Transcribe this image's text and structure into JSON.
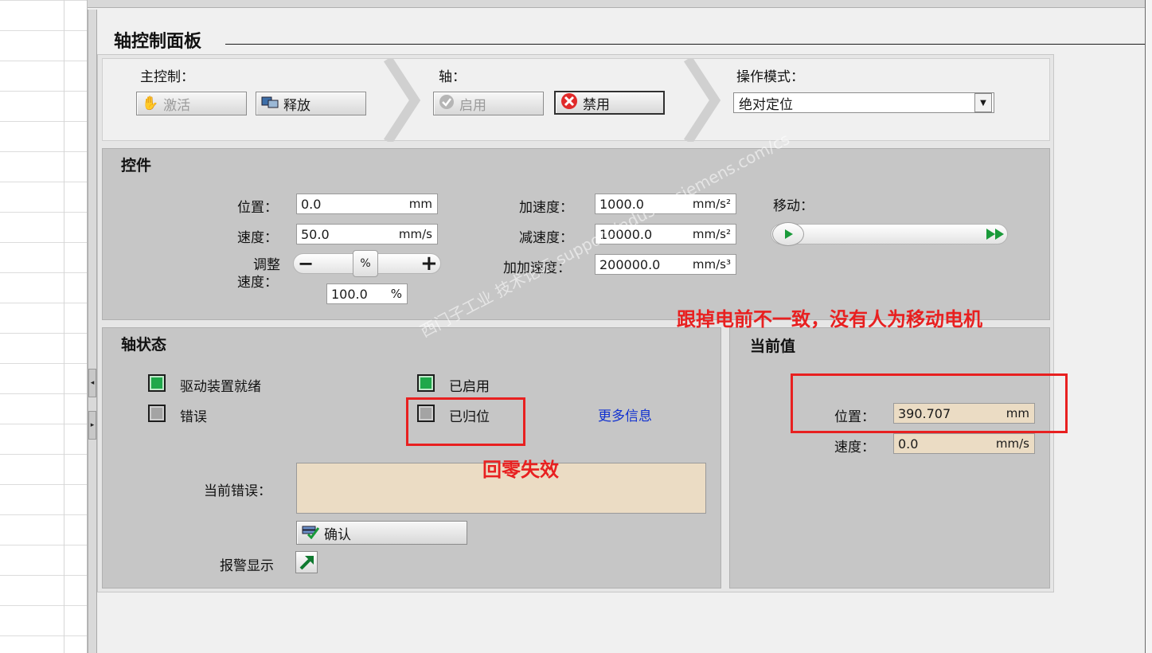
{
  "panel_title": "轴控制面板",
  "master_control": {
    "label": "主控制：",
    "activate_label": "激活",
    "release_label": "释放"
  },
  "axis": {
    "label": "轴：",
    "enable_label": "启用",
    "disable_label": "禁用"
  },
  "operating_mode": {
    "label": "操作模式：",
    "value": "绝对定位"
  },
  "controls": {
    "title": "控件",
    "position": {
      "label": "位置：",
      "value": "0.0",
      "unit": "mm"
    },
    "velocity": {
      "label": "速度：",
      "value": "50.0",
      "unit": "mm/s"
    },
    "override": {
      "label_line1": "调整",
      "label_line2": "速度：",
      "thumb_label": "%",
      "value": "100.0",
      "unit": "%",
      "minus": "−",
      "plus": "+"
    },
    "acceleration": {
      "label": "加速度：",
      "value": "1000.0",
      "unit": "mm/s²"
    },
    "deceleration": {
      "label": "减速度：",
      "value": "10000.0",
      "unit": "mm/s²"
    },
    "jerk": {
      "label": "加加速度：",
      "value": "200000.0",
      "unit": "mm/s³"
    },
    "move": {
      "label": "移动："
    }
  },
  "axis_status": {
    "title": "轴状态",
    "drive_ready": {
      "label": "驱动装置就绪",
      "on": true
    },
    "error": {
      "label": "错误",
      "on": false
    },
    "enabled": {
      "label": "已启用",
      "on": true
    },
    "homed": {
      "label": "已归位",
      "on": false
    },
    "more_info": "更多信息",
    "current_error_label": "当前错误：",
    "current_error_value": "",
    "acknowledge_label": "确认",
    "alarm_display_label": "报警显示"
  },
  "current_values": {
    "title": "当前值",
    "position": {
      "label": "位置：",
      "value": "390.707",
      "unit": "mm"
    },
    "velocity": {
      "label": "速度：",
      "value": "0.0",
      "unit": "mm/s"
    }
  },
  "annotations": {
    "top_note": "跟掉电前不一致，没有人为移动电机",
    "homing_note": "回零失效"
  },
  "watermark": "西门子工业 技术论坛 support.industry.siemens.com/cs",
  "colors": {
    "annotation_red": "#e82020",
    "led_green": "#1fa84a",
    "readonly_field": "#ebdcc4",
    "link_blue": "#1030d0"
  }
}
